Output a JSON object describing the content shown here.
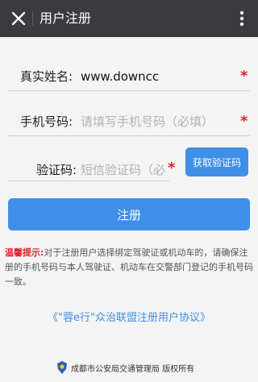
{
  "header": {
    "title": "用户注册",
    "close_icon": "close-icon",
    "more_icon": "more-vertical-icon"
  },
  "form": {
    "name": {
      "label": "真实姓名:",
      "value": "www.downcc",
      "required": "*"
    },
    "phone": {
      "label": "手机号码:",
      "placeholder": "请填写手机号码（必填）",
      "required": "*"
    },
    "code": {
      "label": "验证码:",
      "placeholder": "短信验证码（必填）",
      "required": "*"
    },
    "get_code_label": "获取验证码",
    "submit_label": "注册"
  },
  "tip": {
    "title": "温馨提示:",
    "text": "对于注册用户选择绑定驾驶证或机动车的，请确保注册的手机号码与本人驾驶证、机动车在交警部门登记的手机号码一致。"
  },
  "agreement": "《\"蓉e行\"众治联盟注册用户协议》",
  "footer": "成都市公安局交通管理局 版权所有",
  "colors": {
    "accent": "#3f8fe8",
    "required": "#e0242d",
    "topbar": "#3a3a3f"
  }
}
